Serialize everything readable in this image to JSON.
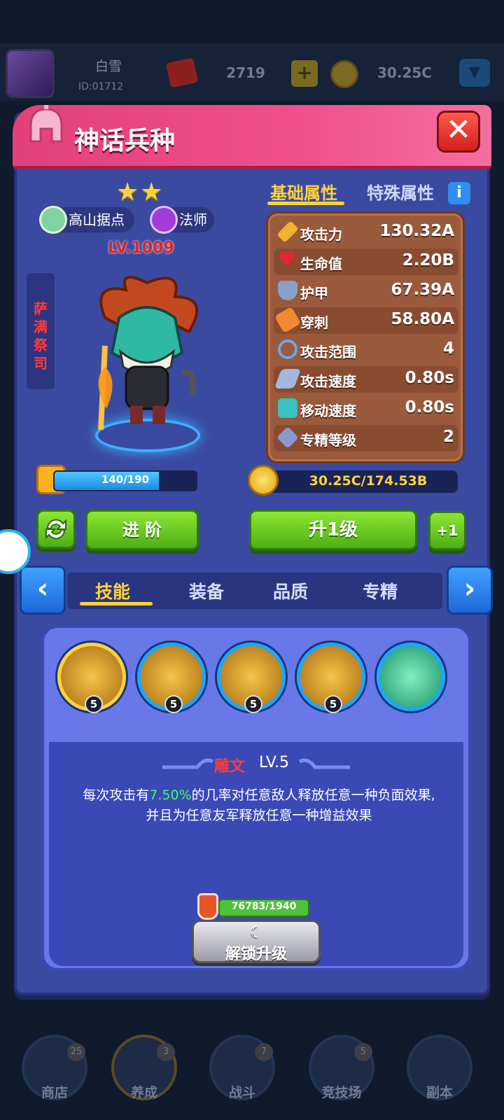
{
  "top_bar": {
    "username": "白雪",
    "user_id": "ID:01712",
    "gems": "2719",
    "coins": "30.25C"
  },
  "panel": {
    "title": "神话兵种",
    "close_label": "✕"
  },
  "hero": {
    "stars": 2,
    "region": "高山据点",
    "class": "法师",
    "level": "LV.1009",
    "name": "萨满祭司",
    "shards_progress": "140/190",
    "shards_fraction": 0.737,
    "upgrade_cost": "30.25C/174.53B"
  },
  "actions": {
    "advance_label": "进 阶",
    "upgrade_label": "升1级",
    "plus_label": "+1"
  },
  "attr_tabs": {
    "basic": "基础属性",
    "special": "特殊属性",
    "info": "i"
  },
  "stats": [
    {
      "label": "攻击力",
      "value": "130.32A",
      "icon": "sword-icon",
      "color": "#f0b030"
    },
    {
      "label": "生命值",
      "value": "2.20B",
      "icon": "heart-icon",
      "color": "#e2253a"
    },
    {
      "label": "护甲",
      "value": "67.39A",
      "icon": "shield-icon",
      "color": "#8aa0c8"
    },
    {
      "label": "穿刺",
      "value": "58.80A",
      "icon": "pierce-icon",
      "color": "#f08a30"
    },
    {
      "label": "攻击范围",
      "value": "4",
      "icon": "range-icon",
      "color": "#6aa8e8"
    },
    {
      "label": "攻击速度",
      "value": "0.80s",
      "icon": "attack-speed-icon",
      "color": "#a0b8e0"
    },
    {
      "label": "移动速度",
      "value": "0.80s",
      "icon": "boot-icon",
      "color": "#3ac0c0"
    },
    {
      "label": "专精等级",
      "value": "2",
      "icon": "mastery-icon",
      "color": "#8a9ad0"
    }
  ],
  "sub_tabs": [
    "技能",
    "装备",
    "品质",
    "专精"
  ],
  "skills": {
    "levels": [
      "5",
      "5",
      "5",
      "5"
    ],
    "selected_name": "雕文",
    "selected_level": "LV.5",
    "desc_prefix": "每次攻击有",
    "desc_highlight": "7.50%",
    "desc_suffix": "的几率对任意敌人释放任意一种负面效果,",
    "desc_line2": "并且为任意友军释放任意一种增益效果",
    "material_progress": "76783/1940",
    "unlock_label": "解锁升级",
    "unlock_icon": "moon-icon"
  },
  "bottom_nav": [
    {
      "label": "商店",
      "badge": "25"
    },
    {
      "label": "养成",
      "badge": "3"
    },
    {
      "label": "战斗",
      "badge": "7"
    },
    {
      "label": "竞技场",
      "badge": "5"
    },
    {
      "label": "副本",
      "badge": ""
    }
  ],
  "colors": {
    "header_pink": "#e2417a",
    "panel_blue": "#3a4aa0",
    "accent_gold": "#ffd23a",
    "level_red": "#e62222",
    "button_green": "#4fae15"
  }
}
